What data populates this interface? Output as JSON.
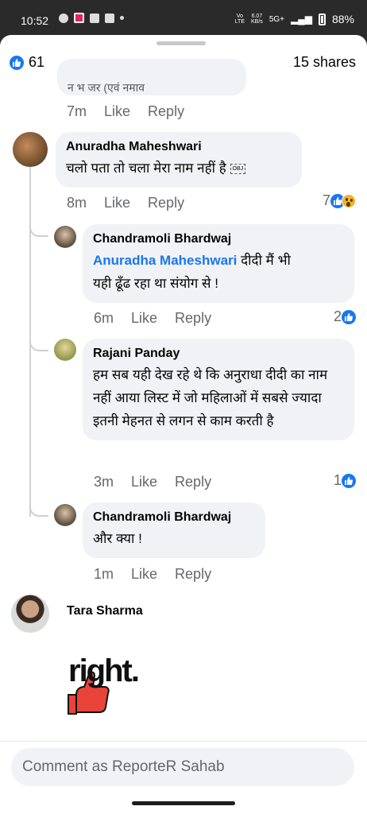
{
  "status_bar": {
    "time": "10:52",
    "net_speed_top": "6.07",
    "net_speed_bottom": "KB/s",
    "network": "5G+",
    "battery": "88%"
  },
  "reactions_summary": {
    "count": "61",
    "shares": "15 shares"
  },
  "comments": [
    {
      "partial_text": "न भ जर (एवं नमाव",
      "time": "7m",
      "like": "Like",
      "reply": "Reply"
    },
    {
      "author": "Anuradha Maheshwari",
      "text": "चलो पता तो चला मेरा नाम नहीं है",
      "obj": "OBJ",
      "time": "8m",
      "like": "Like",
      "reply": "Reply",
      "reaction_count": "7"
    },
    {
      "author": "Chandramoli Bhardwaj",
      "mention": "Anuradha Maheshwari",
      "text_after_mention": " दीदी मैं भी",
      "text_line2": "यही ढूँढ रहा था संयोग से  !",
      "time": "6m",
      "like": "Like",
      "reply": "Reply",
      "reaction_count": "2"
    },
    {
      "author": "Rajani Panday",
      "text": "हम सब यही देख रहे थे कि अनुराधा दीदी का नाम नहीं आया लिस्ट में जो महिलाओं में सबसे ज्यादा इतनी मेहनत से लगन से काम करती है",
      "time": "3m",
      "like": "Like",
      "reply": "Reply",
      "reaction_count": "1"
    },
    {
      "author": "Chandramoli Bhardwaj",
      "text": "और क्या  !",
      "time": "1m",
      "like": "Like",
      "reply": "Reply"
    },
    {
      "author": "Tara Sharma",
      "sticker_text": "right."
    }
  ],
  "composer": {
    "placeholder": "Comment as ReporteR Sahab"
  },
  "colors": {
    "accent": "#1877f2",
    "bubble": "#f0f2f5",
    "meta": "#65676b"
  }
}
